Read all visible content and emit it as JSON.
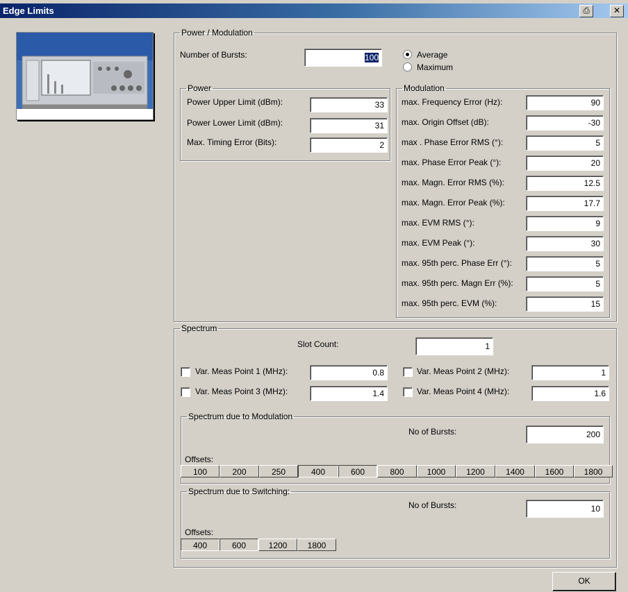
{
  "window": {
    "title": "Edge Limits"
  },
  "power_mod": {
    "legend": "Power / Modulation",
    "bursts_label": "Number of Bursts:",
    "bursts_value": "100",
    "radio_average": "Average",
    "radio_maximum": "Maximum",
    "power": {
      "legend": "Power",
      "rows": [
        {
          "label": "Power Upper Limit (dBm):",
          "value": "33"
        },
        {
          "label": "Power Lower Limit (dBm):",
          "value": "31"
        },
        {
          "label": "Max. Timing Error (Bits):",
          "value": "2"
        }
      ]
    },
    "modulation": {
      "legend": "Modulation",
      "rows": [
        {
          "label": "max. Frequency Error (Hz):",
          "value": "90"
        },
        {
          "label": "max. Origin Offset (dB):",
          "value": "-30"
        },
        {
          "label": "max . Phase Error RMS (°):",
          "value": "5"
        },
        {
          "label": "max. Phase Error Peak (°):",
          "value": "20"
        },
        {
          "label": "max. Magn. Error RMS (%):",
          "value": "12.5"
        },
        {
          "label": "max. Magn. Error Peak (%):",
          "value": "17.7"
        },
        {
          "label": "max. EVM RMS (°):",
          "value": "9"
        },
        {
          "label": "max. EVM Peak (°):",
          "value": "30"
        },
        {
          "label": "max. 95th perc. Phase Err (°):",
          "value": "5"
        },
        {
          "label": "max. 95th perc. Magn Err (%):",
          "value": "5"
        },
        {
          "label": "max. 95th perc. EVM (%):",
          "value": "15"
        }
      ]
    }
  },
  "spectrum": {
    "legend": "Spectrum",
    "slot_label": "Slot Count:",
    "slot_value": "1",
    "meas": [
      {
        "label": "Var. Meas Point 1 (MHz):",
        "value": "0.8"
      },
      {
        "label": "Var. Meas Point 2 (MHz):",
        "value": "1"
      },
      {
        "label": "Var. Meas Point 3 (MHz):",
        "value": "1.4"
      },
      {
        "label": "Var. Meas Point 4 (MHz):",
        "value": "1.6"
      }
    ],
    "mod": {
      "legend": "Spectrum due to Modulation",
      "bursts_label": "No of Bursts:",
      "bursts_value": "200",
      "offsets_label": "Offsets:",
      "offsets": [
        "100",
        "200",
        "250",
        "400",
        "600",
        "800",
        "1000",
        "1200",
        "1400",
        "1600",
        "1800"
      ]
    },
    "sw": {
      "legend": "Spectrum due to Switching:",
      "bursts_label": "No of Bursts:",
      "bursts_value": "10",
      "offsets_label": "Offsets:",
      "offsets": [
        "400",
        "600",
        "1200",
        "1800"
      ]
    }
  },
  "ok_label": "OK"
}
